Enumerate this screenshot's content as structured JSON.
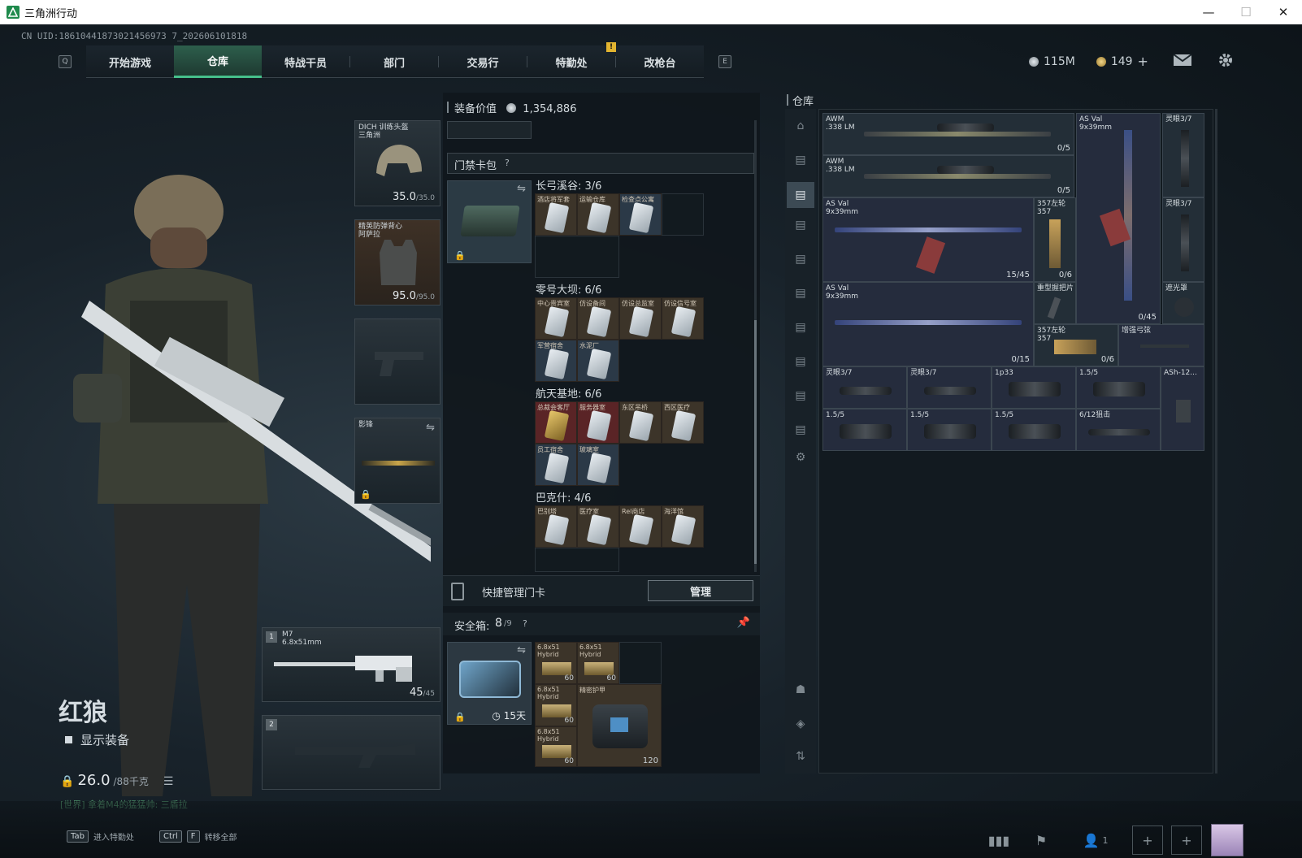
{
  "window": {
    "title": "三角洲行动",
    "minimize": "—",
    "maximize": "☐",
    "close": "✕"
  },
  "uid": "CN UID:18610441873021456973 7_202606101818",
  "nav": {
    "left_key": "Q",
    "right_key": "E",
    "alert": "!",
    "tabs": [
      "开始游戏",
      "仓库",
      "特战干员",
      "部门",
      "交易行",
      "特勤处",
      "改枪台"
    ],
    "active_tab": "仓库"
  },
  "currency": {
    "silver": "115M",
    "gold": "149",
    "add": "+"
  },
  "character": {
    "name": "红狼",
    "show_equipment": "显示装备",
    "weight": "26.0",
    "weight_cap": "/88千克",
    "chat": "[世界] 拿着M4的猛猛帅: 三盾拉"
  },
  "equipment": {
    "helmet": {
      "name": "DICH 训练头盔",
      "sub": "三角洲",
      "value": "35.0",
      "max": "/35.0"
    },
    "armor": {
      "name": "精英防弹背心",
      "sub": "阿萨拉",
      "value": "95.0",
      "max": "/95.0"
    },
    "melee": {
      "name": "影锋"
    },
    "primary": {
      "num": "1",
      "name": "M7",
      "caliber": "6.8x51mm",
      "ammo": "45",
      "ammo_max": "/45"
    },
    "secondary": {
      "num": "2"
    }
  },
  "center": {
    "equip_value_label": "装备价值",
    "equip_value": "1,354,886",
    "keycard_pack": "门禁卡包",
    "help": "?",
    "groups": [
      {
        "title": "长弓溪谷: 3/6",
        "cards": [
          "酒店将军套",
          "运输仓库",
          "检查点公寓"
        ]
      },
      {
        "title": "零号大坝: 6/6",
        "cards": [
          "中心贵宾室",
          "仿设备间",
          "仿设总监室",
          "仿设信号室",
          "军营宿舍",
          "水泥厂"
        ]
      },
      {
        "title": "航天基地: 6/6",
        "cards": [
          "总裁会客厅",
          "服务器室",
          "东区吊桥",
          "西区医疗",
          "员工宿舍",
          "玻璃室"
        ]
      },
      {
        "title": "巴克什: 4/6",
        "cards": [
          "巴别塔",
          "医疗室",
          "Rel商店",
          "海洋馆"
        ]
      }
    ],
    "quick_manage": "快捷管理门卡",
    "manage_btn": "管理",
    "safe_box_label": "安全箱:",
    "safe_box_count": "8",
    "safe_box_cap": "/9",
    "safe_days": "15天",
    "safe_items": [
      {
        "name": "6.8x51 Hybrid",
        "qty": "60"
      },
      {
        "name": "6.8x51 Hybrid",
        "qty": "60"
      },
      {
        "name": "6.8x51 Hybrid",
        "qty": "60"
      },
      {
        "name": "6.8x51 Hybrid",
        "qty": "60"
      },
      {
        "name": "精密护甲",
        "qty": "120"
      }
    ]
  },
  "warehouse": {
    "label": "仓库",
    "items": [
      {
        "name": "AWM",
        "sub": ".338 LM",
        "count": "0/5"
      },
      {
        "name": "AWM",
        "sub": ".338 LM",
        "count": "0/5"
      },
      {
        "name": "AS Val",
        "sub": "9x39mm",
        "count": "15/45"
      },
      {
        "name": "AS Val",
        "sub": "9x39mm",
        "count": "0/15"
      },
      {
        "name": "AS Val",
        "sub": "9x39mm",
        "count": "0/45"
      },
      {
        "name": "357左轮",
        "sub": "357",
        "count": "0/6"
      },
      {
        "name": "357左轮",
        "sub": "357",
        "count": "0/6"
      },
      {
        "name": "重型握把片",
        "sub": "",
        "count": ""
      },
      {
        "name": "增强弓弦",
        "sub": "",
        "count": ""
      },
      {
        "name": "灵眼3/7",
        "sub": "",
        "count": ""
      },
      {
        "name": "灵眼3/7",
        "sub": "",
        "count": ""
      },
      {
        "name": "遮光罩",
        "sub": "",
        "count": ""
      },
      {
        "name": "灵眼3/7",
        "sub": "",
        "count": ""
      },
      {
        "name": "灵眼3/7",
        "sub": "",
        "count": ""
      },
      {
        "name": "1p33",
        "sub": "",
        "count": ""
      },
      {
        "name": "1.5/5",
        "sub": "",
        "count": ""
      },
      {
        "name": "ASh-12...",
        "sub": "",
        "count": ""
      },
      {
        "name": "1.5/5",
        "sub": "",
        "count": ""
      },
      {
        "name": "1.5/5",
        "sub": "",
        "count": ""
      },
      {
        "name": "1.5/5",
        "sub": "",
        "count": ""
      },
      {
        "name": "6/12狙击",
        "sub": "",
        "count": ""
      }
    ]
  },
  "bottom": {
    "hotkey1_key": "Tab",
    "hotkey1_label": "进入特勤处",
    "hotkey2_key1": "Ctrl",
    "hotkey2_key2": "F",
    "hotkey2_label": "转移全部",
    "friends_count": "1"
  },
  "colors": {
    "accent": "#46c08b",
    "gold": "#c9a44a",
    "panel": "#10171c"
  }
}
